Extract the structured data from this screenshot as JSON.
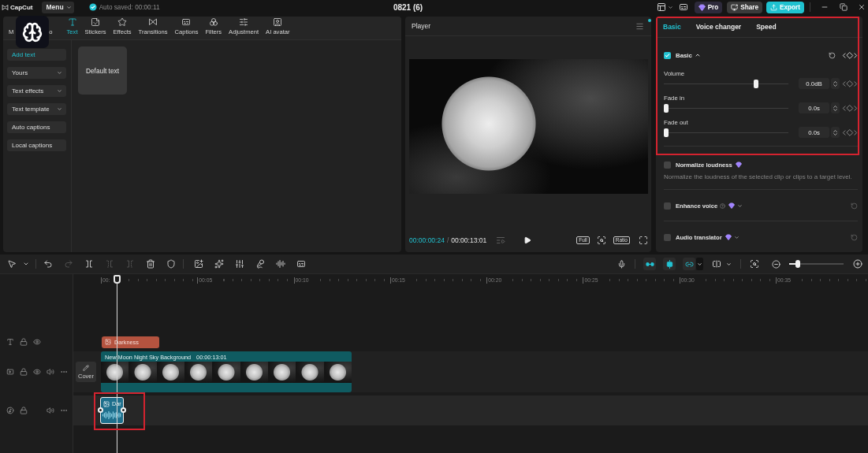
{
  "title_bar": {
    "app_name": "CapCut",
    "menu": "Menu",
    "autosave": "Auto saved: 00:00:11",
    "project_title": "0821 (6)",
    "buttons": [
      {
        "kind": "pro",
        "label": "Pro"
      },
      {
        "kind": "share",
        "label": "Share"
      },
      {
        "kind": "export",
        "label": "Export"
      }
    ]
  },
  "media_panel": {
    "tabs": [
      {
        "label": "M",
        "selected": false
      },
      {
        "label": "o",
        "selected": false
      },
      {
        "label": "Text",
        "selected": true
      },
      {
        "label": "Stickers",
        "selected": false
      },
      {
        "label": "Effects",
        "selected": false
      },
      {
        "label": "Transitions",
        "selected": false
      },
      {
        "label": "Captions",
        "selected": false
      },
      {
        "label": "Filters",
        "selected": false
      },
      {
        "label": "Adjustment",
        "selected": false
      },
      {
        "label": "AI avatar",
        "selected": false
      }
    ],
    "sidebar": [
      {
        "label": "Add text",
        "kind": "item",
        "selected": true
      },
      {
        "label": "Yours",
        "kind": "menu",
        "selected": false
      },
      {
        "label": "Text effects",
        "kind": "menu",
        "selected": false
      },
      {
        "label": "Text template",
        "kind": "menu",
        "selected": false
      },
      {
        "label": "Auto captions",
        "kind": "item",
        "selected": false
      },
      {
        "label": "Local captions",
        "kind": "item",
        "selected": false
      }
    ],
    "presets": [
      {
        "label": "Default text"
      }
    ]
  },
  "player": {
    "title": "Player",
    "current_time": "00:00:00:24",
    "separator": "/",
    "total_time": "00:00:13:01",
    "view_buttons": [
      "Full",
      "Ratio"
    ]
  },
  "inspector": {
    "tabs": [
      {
        "label": "Basic",
        "selected": true
      },
      {
        "label": "Voice changer",
        "selected": false
      },
      {
        "label": "Speed",
        "selected": false
      }
    ],
    "section": {
      "label": "Basic",
      "checked": true,
      "expanded": true
    },
    "sliders": [
      {
        "label": "Volume",
        "level": 0.75,
        "value": "0.0dB"
      },
      {
        "label": "Fade in",
        "level": 0,
        "value": "0.0s"
      },
      {
        "label": "Fade out",
        "level": 0,
        "value": "0.0s"
      }
    ],
    "options": [
      {
        "kind": "described",
        "label": "Normalize loudness",
        "checked": false,
        "description": "Normalize the loudness of the selected clip or clips to a target level."
      },
      {
        "kind": "help-menu",
        "label": "Enhance voice",
        "checked": false
      },
      {
        "kind": "menu",
        "label": "Audio translator",
        "checked": false
      }
    ]
  },
  "timeline": {
    "tools": [
      {
        "kind": "select",
        "disabled": false
      },
      {
        "kind": "undo",
        "disabled": false
      },
      {
        "kind": "redo",
        "disabled": true
      },
      {
        "kind": "split",
        "disabled": false
      },
      {
        "kind": "trim-left",
        "disabled": true
      },
      {
        "kind": "trim-right",
        "disabled": true
      },
      {
        "kind": "delete",
        "disabled": false
      },
      {
        "kind": "marker",
        "disabled": false
      },
      {
        "kind": "freeze",
        "disabled": false
      },
      {
        "kind": "ai-effect",
        "disabled": false
      },
      {
        "kind": "adjust",
        "disabled": false
      },
      {
        "kind": "voice-fx",
        "disabled": false
      },
      {
        "kind": "audio",
        "disabled": false
      },
      {
        "kind": "captions",
        "disabled": false
      }
    ],
    "toggles": [
      {
        "kind": "main-link",
        "on": true
      },
      {
        "kind": "snap",
        "on": true
      },
      {
        "kind": "linkage",
        "on": true
      }
    ],
    "zoom": {
      "level": 0.12
    },
    "ruler": [
      "00:",
      "00:05",
      "00:10",
      "00:15",
      "00:20",
      "00:25",
      "00:30",
      "00:35"
    ],
    "tracks": [
      {
        "kind": "text",
        "clips": [
          {
            "label": "Darkness",
            "color": "#b4533f",
            "selected": false
          }
        ]
      },
      {
        "kind": "video",
        "cover": "Cover",
        "clips": [
          {
            "label": "New Moon Night Sky Background",
            "duration": "00:00:13:01",
            "color": "#0f5b61",
            "selected": false
          }
        ]
      },
      {
        "kind": "audio",
        "clips": [
          {
            "label": "Dar",
            "color": "#1e6f8c",
            "selected": true
          }
        ]
      }
    ]
  }
}
